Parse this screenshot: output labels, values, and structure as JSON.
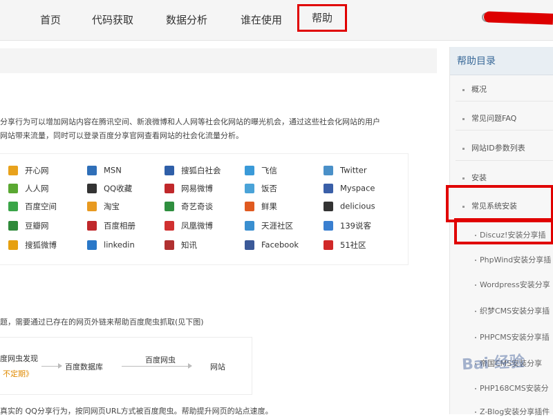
{
  "nav": {
    "items": [
      "首页",
      "代码获取",
      "数据分析",
      "谁在使用"
    ],
    "help": "帮助"
  },
  "content": {
    "intro_line1": "分享行为可以增加网站内容在腾讯空间、新浪微博和人人网等社会化网站的曝光机会，通过这些社会化网站的用户",
    "intro_line2": "网站带来流量，同时可以登录百度分享官网查看网站的社会化流量分析。",
    "services": [
      [
        "开心网",
        "MSN",
        "搜狐白社会",
        "飞信",
        "Twitter"
      ],
      [
        "人人网",
        "QQ收藏",
        "网易微博",
        "饭否",
        "Myspace"
      ],
      [
        "百度空间",
        "淘宝",
        "奇艺奇谈",
        "鲜果",
        "delicious"
      ],
      [
        "豆瓣网",
        "百度相册",
        "凤凰微博",
        "天涯社区",
        "139说客"
      ],
      [
        "搜狐微博",
        "linkedin",
        "知讯",
        "Facebook",
        "51社区"
      ]
    ],
    "service_colors": [
      [
        "#e8a21c",
        "#2f6fb8",
        "#2f5fa8",
        "#3a9ad8",
        "#4a90c8"
      ],
      [
        "#5aa832",
        "#333333",
        "#c0282b",
        "#4aa3d8",
        "#3a5fa8"
      ],
      [
        "#3aa548",
        "#e89a20",
        "#2f8f3f",
        "#e05a20",
        "#333333"
      ],
      [
        "#2f8a3a",
        "#c0282b",
        "#d03030",
        "#3a8fd0",
        "#3a7fd0"
      ],
      [
        "#e6a010",
        "#2a78c8",
        "#b03030",
        "#3b5998",
        "#d02828"
      ]
    ],
    "crawl_note": "题，需要通过已存在的网页外链来帮助百度爬虫抓取(见下图)",
    "flow": {
      "a": "度网虫发现",
      "a_sub": "不定期》",
      "b": "百度数据库",
      "c": "百度网虫",
      "d": "网站"
    },
    "bottom_text": "真实的 QQ分享行为，按同网页URL方式被百度爬虫。帮助提升网页的站点速度。"
  },
  "sidebar": {
    "title": "帮助目录",
    "items": [
      "概况",
      "常见问题FAQ",
      "网站ID参数列表",
      "安装",
      "常见系统安装"
    ],
    "sub_items": [
      "Discuz!安装分享插",
      "PhpWind安装分享插",
      "Wordpress安装分享",
      "织梦CMS安装分享插",
      "PHPCMS安装分享插",
      "帝国CMS安装分享",
      "PHP168CMS安装分",
      "Z-Blog安装分享插件"
    ]
  },
  "watermark": "Bai 经验"
}
